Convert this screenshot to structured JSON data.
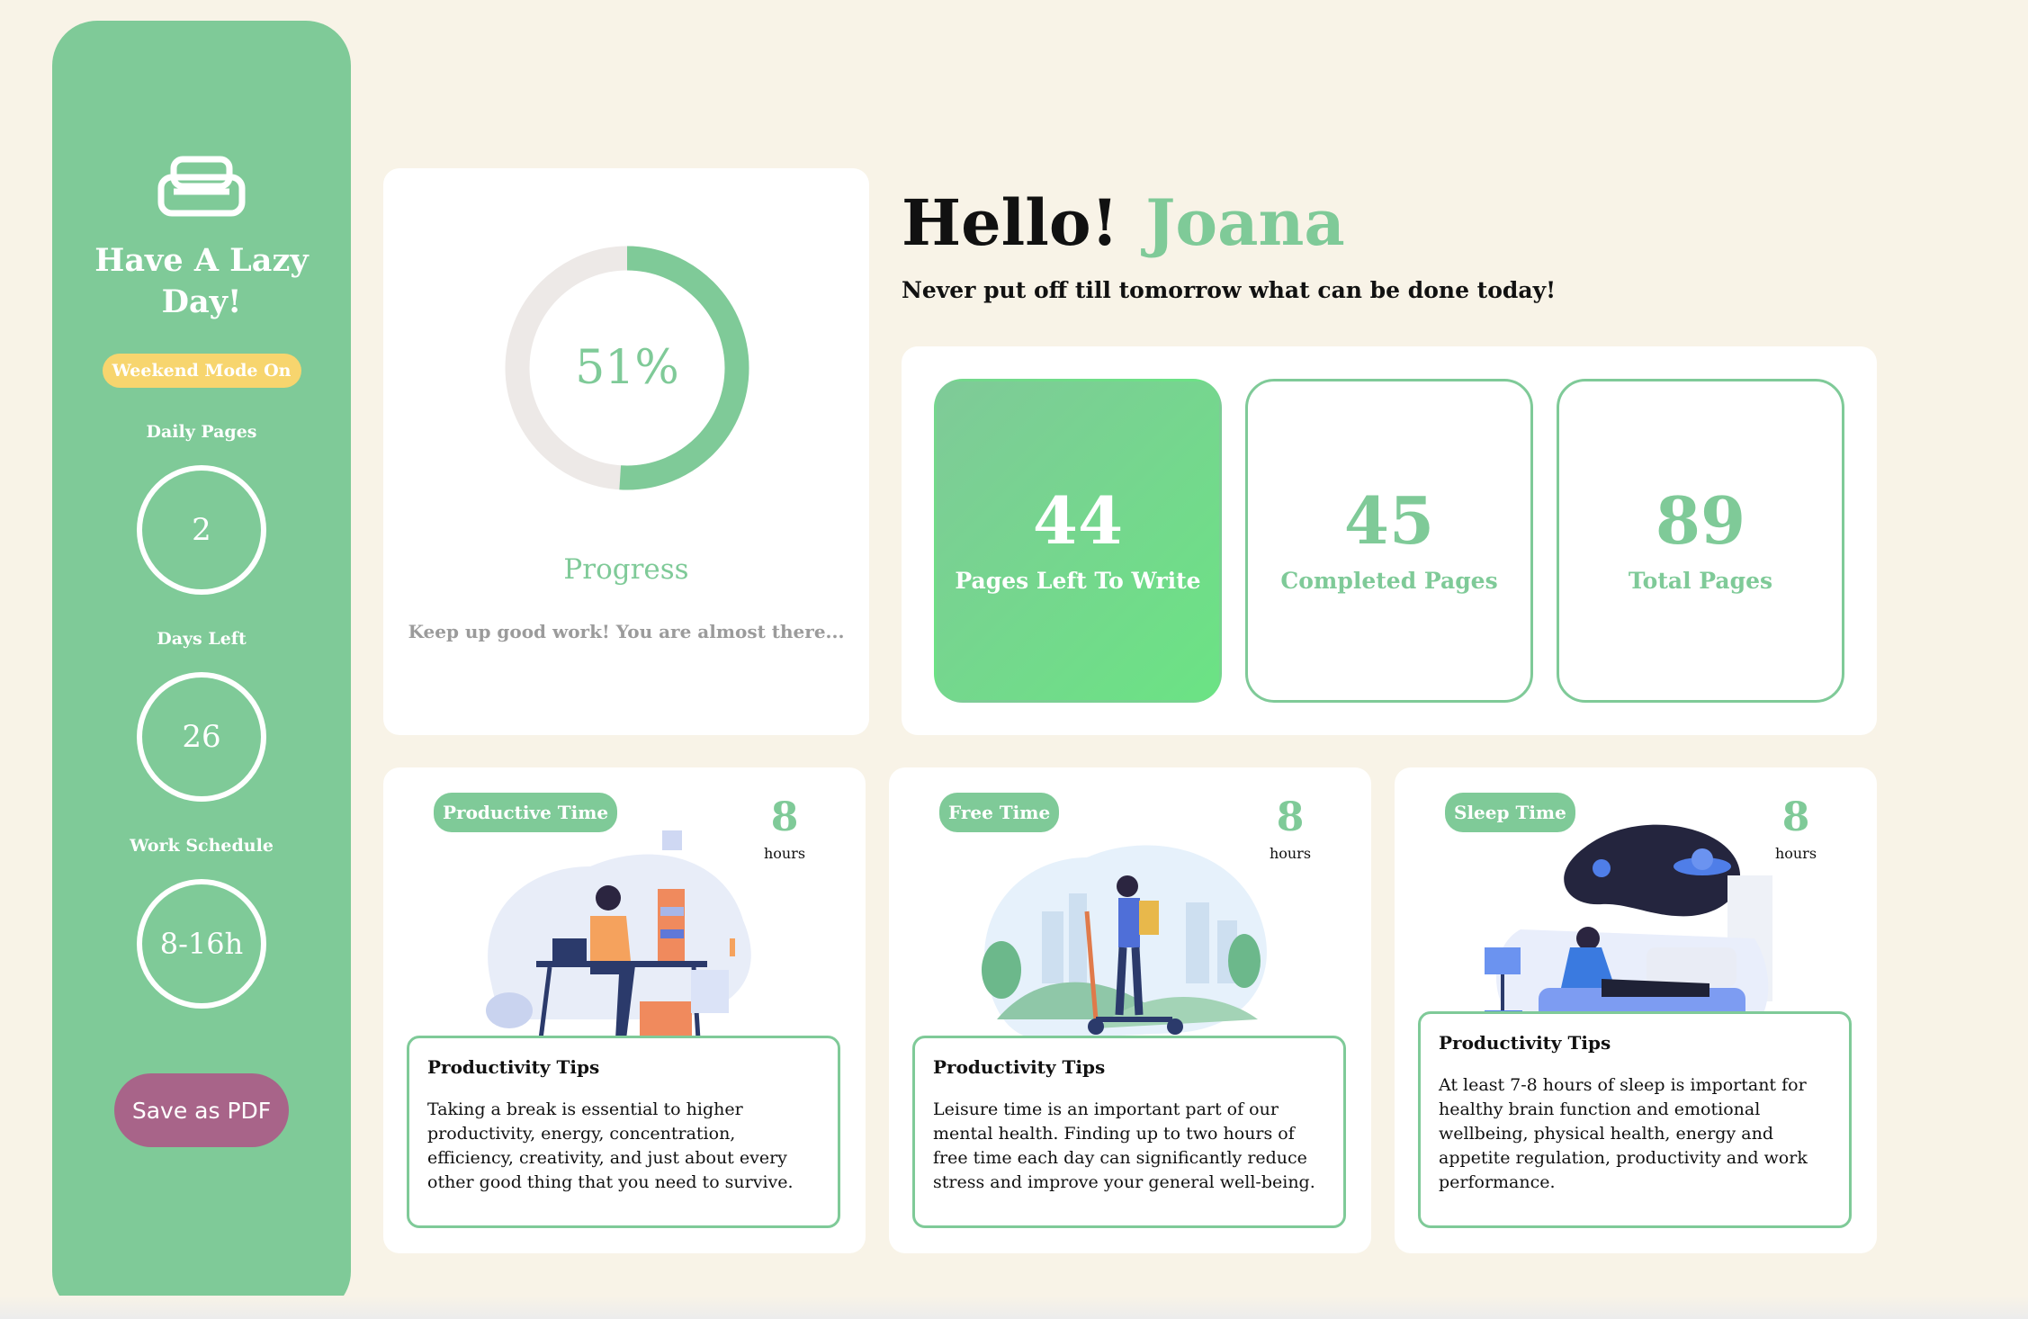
{
  "sidebar": {
    "title": "Have A Lazy Day!",
    "badge": "Weekend Mode On",
    "daily_pages_label": "Daily Pages",
    "daily_pages_value": "2",
    "days_left_label": "Days Left",
    "days_left_value": "26",
    "work_schedule_label": "Work Schedule",
    "work_schedule_value": "8-16h",
    "save_button": "Save as PDF",
    "icon": "sofa-icon"
  },
  "progress": {
    "percent_text": "51%",
    "percent": 51,
    "title": "Progress",
    "subtitle": "Keep up good work! You are almost there..."
  },
  "header": {
    "greeting": "Hello!",
    "name": "Joana",
    "quote": "Never put off till tomorrow what can be done today!"
  },
  "stats": [
    {
      "value": "44",
      "label": "Pages Left To Write"
    },
    {
      "value": "45",
      "label": "Completed Pages"
    },
    {
      "value": "89",
      "label": "Total Pages"
    }
  ],
  "time_cards": [
    {
      "pill": "Productive Time",
      "hours": "8",
      "unit": "hours",
      "tips_title": "Productivity Tips",
      "tips_body": "Taking a break is essential to higher productivity, energy, concentration, efficiency, creativity, and just about every other good thing that you need to survive.",
      "illustration": "working-desk-illustration"
    },
    {
      "pill": "Free Time",
      "hours": "8",
      "unit": "hours",
      "tips_title": "Productivity Tips",
      "tips_body": "Leisure time is an important part of our mental health. Finding up to two hours of free time each day can significantly reduce stress and improve your general well-being.",
      "illustration": "scooter-park-illustration"
    },
    {
      "pill": "Sleep Time",
      "hours": "8",
      "unit": "hours",
      "tips_title": "Productivity Tips",
      "tips_body": "At least 7-8 hours of sleep is important for healthy brain function and emotional wellbeing, physical health, energy and appetite regulation, productivity and work performance.",
      "illustration": "sleeping-dream-illustration"
    }
  ],
  "colors": {
    "accent": "#7fca98",
    "badge": "#f7d56e",
    "button": "#a86489",
    "background": "#f8f3e7"
  }
}
